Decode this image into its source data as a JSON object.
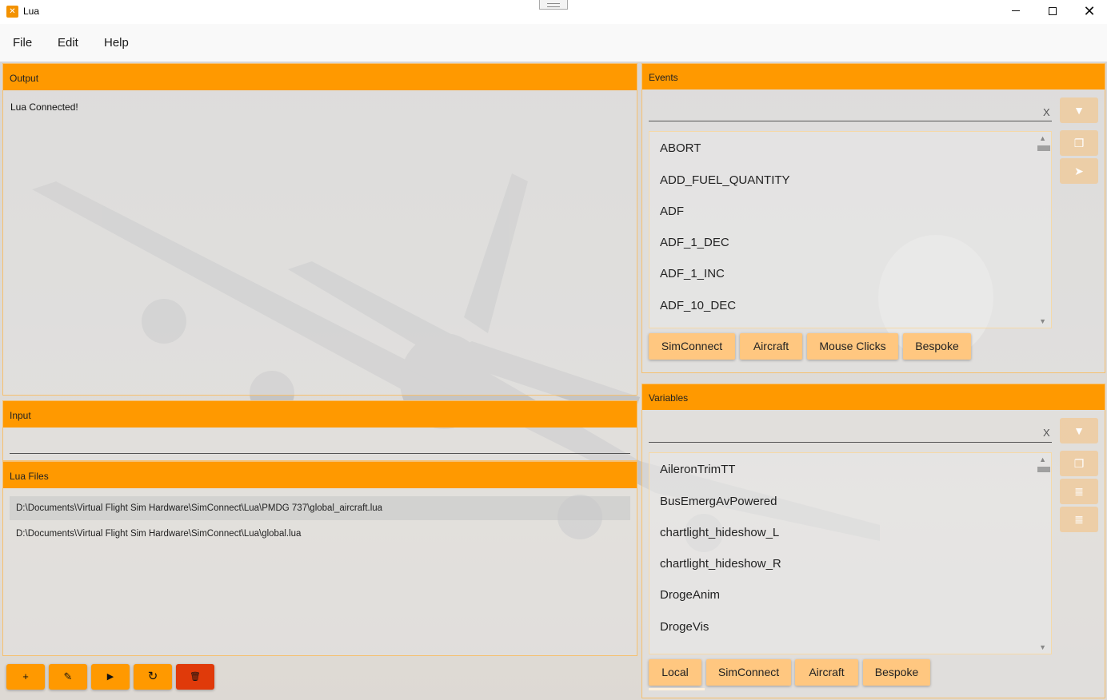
{
  "window": {
    "title": "Lua"
  },
  "menu": {
    "items": [
      "File",
      "Edit",
      "Help"
    ]
  },
  "output": {
    "header": "Output",
    "text": "Lua Connected!"
  },
  "input": {
    "header": "Input",
    "value": ""
  },
  "lua_files": {
    "header": "Lua Files",
    "files": [
      "D:\\Documents\\Virtual Flight Sim Hardware\\SimConnect\\Lua\\PMDG 737\\global_aircraft.lua",
      "D:\\Documents\\Virtual Flight Sim Hardware\\SimConnect\\Lua\\global.lua"
    ],
    "selected_index": 0
  },
  "toolbar": {
    "buttons": [
      {
        "name": "add",
        "icon": "plus-icon",
        "glyph": "+"
      },
      {
        "name": "edit",
        "icon": "pencil-icon",
        "glyph": "✎"
      },
      {
        "name": "run",
        "icon": "play-icon",
        "glyph": "▶"
      },
      {
        "name": "reload",
        "icon": "refresh-icon",
        "glyph": "↻"
      },
      {
        "name": "delete",
        "icon": "trash-icon",
        "glyph": "🗑"
      }
    ]
  },
  "events": {
    "header": "Events",
    "search_clear": "X",
    "items": [
      "ABORT",
      "ADD_FUEL_QUANTITY",
      "ADF",
      "ADF_1_DEC",
      "ADF_1_INC",
      "ADF_10_DEC"
    ],
    "categories": [
      "SimConnect",
      "Aircraft",
      "Mouse Clicks",
      "Bespoke"
    ],
    "side_buttons": [
      "filter-icon",
      "copy-icon",
      "send-icon"
    ]
  },
  "variables": {
    "header": "Variables",
    "search_clear": "X",
    "items": [
      "AileronTrimTT",
      "BusEmergAvPowered",
      "chartlight_hideshow_L",
      "chartlight_hideshow_R",
      "DrogeAnim",
      "DrogeVis"
    ],
    "categories": [
      "Local",
      "SimConnect",
      "Aircraft",
      "Bespoke"
    ],
    "active_category": "Local",
    "side_buttons": [
      "filter-icon",
      "copy-icon",
      "database-icon",
      "database-edit-icon"
    ]
  },
  "colors": {
    "accent": "#ff9900",
    "danger": "#e03a0a",
    "category_button": "#ffc780"
  }
}
